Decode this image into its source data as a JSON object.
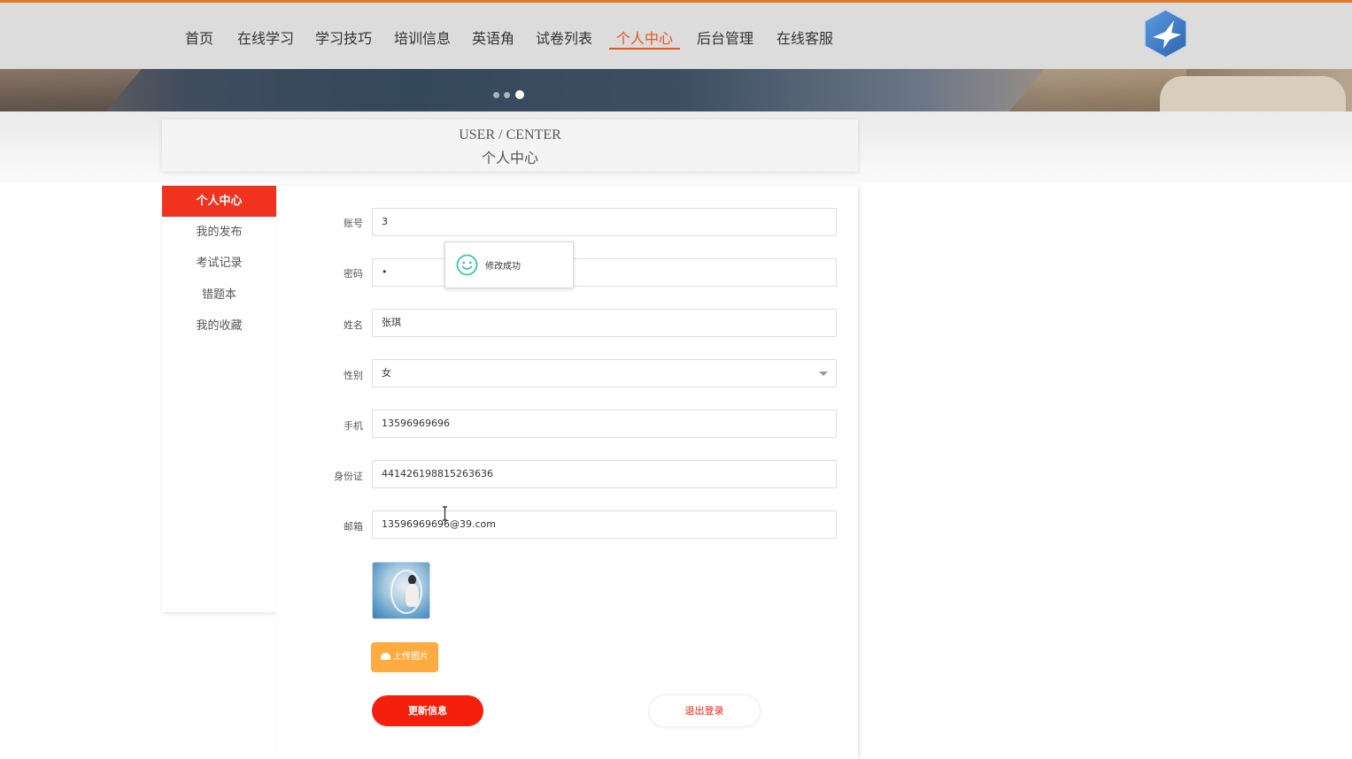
{
  "nav": {
    "items": [
      "首页",
      "在线学习",
      "学习技巧",
      "培训信息",
      "英语角",
      "试卷列表",
      "个人中心",
      "后台管理",
      "在线客服"
    ],
    "active": "个人中心"
  },
  "colors": {
    "accent": "#f0321e",
    "nav_active": "#e0561b",
    "upload": "#ffab40",
    "logo": "#3d7fc9"
  },
  "carousel": {
    "slide_count": 3,
    "active_slide": 3
  },
  "page_title": {
    "en": "USER / CENTER",
    "zh": "个人中心"
  },
  "sidebar": {
    "items": [
      {
        "label": "个人中心",
        "active": true
      },
      {
        "label": "我的发布",
        "active": false
      },
      {
        "label": "考试记录",
        "active": false
      },
      {
        "label": "错题本",
        "active": false
      },
      {
        "label": "我的收藏",
        "active": false
      }
    ]
  },
  "form": {
    "account": {
      "label": "账号",
      "value": "3"
    },
    "password": {
      "label": "密码",
      "value": "•"
    },
    "name": {
      "label": "姓名",
      "value": "张琪"
    },
    "gender": {
      "label": "性别",
      "value": "女"
    },
    "phone": {
      "label": "手机",
      "value": "13596969696"
    },
    "id_card": {
      "label": "身份证",
      "value": "441426198815263636"
    },
    "email": {
      "label": "邮箱",
      "value": "13596969696@39.com"
    }
  },
  "buttons": {
    "upload": "上传图片",
    "update": "更新信息",
    "logout": "退出登录"
  },
  "toast": {
    "message": "修改成功",
    "icon": "smile-icon"
  },
  "icons": {
    "logo": "bird-logo-icon",
    "upload": "cloud-upload-icon",
    "select": "chevron-down-icon",
    "cursor": "text-cursor-icon"
  }
}
